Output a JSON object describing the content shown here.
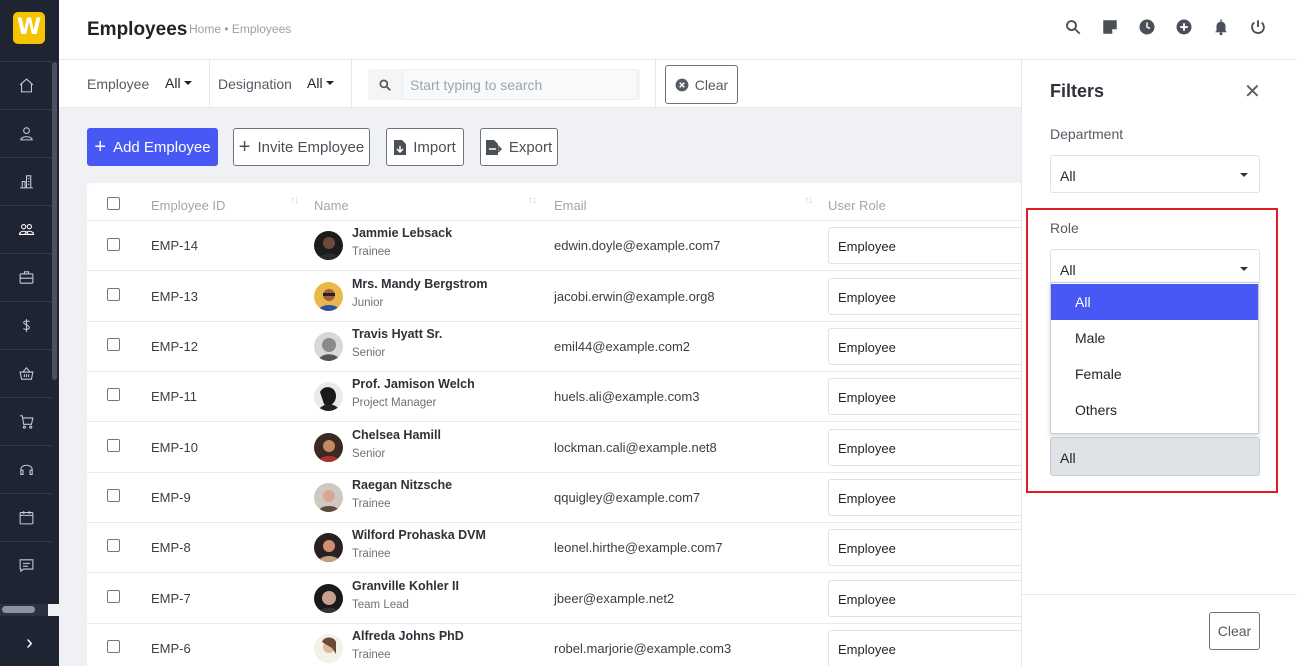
{
  "app": {
    "logo_letter": "W",
    "brand_color": "#f5c400"
  },
  "header": {
    "title": "Employees",
    "breadcrumb": "Home • Employees",
    "icons": [
      "search-icon",
      "sticky-note-icon",
      "clock-icon",
      "plus-circle-icon",
      "bell-icon",
      "power-icon"
    ]
  },
  "sidebar": {
    "items": [
      "home-icon",
      "user-icon",
      "building-icon",
      "users-icon",
      "briefcase-icon",
      "dollar-icon",
      "basket-icon",
      "cart-icon",
      "headset-icon",
      "calendar-icon",
      "message-icon"
    ],
    "expand_glyph": "›"
  },
  "filterbar": {
    "employee_label": "Employee",
    "employee_value": "All",
    "designation_label": "Designation",
    "designation_value": "All",
    "search_placeholder": "Start typing to search",
    "clear_label": "Clear"
  },
  "actions": {
    "add_label": "Add Employee",
    "invite_label": "Invite Employee",
    "import_label": "Import",
    "export_label": "Export",
    "accent_color": "#4758f5"
  },
  "table": {
    "columns": [
      "Employee ID",
      "Name",
      "Email",
      "User Role"
    ],
    "rows": [
      {
        "id": "EMP-14",
        "name": "Jammie Lebsack",
        "designation": "Trainee",
        "email": "edwin.doyle@example.com7",
        "role": "Employee"
      },
      {
        "id": "EMP-13",
        "name": "Mrs. Mandy Bergstrom",
        "designation": "Junior",
        "email": "jacobi.erwin@example.org8",
        "role": "Employee"
      },
      {
        "id": "EMP-12",
        "name": "Travis Hyatt Sr.",
        "designation": "Senior",
        "email": "emil44@example.com2",
        "role": "Employee"
      },
      {
        "id": "EMP-11",
        "name": "Prof. Jamison Welch",
        "designation": "Project Manager",
        "email": "huels.ali@example.com3",
        "role": "Employee"
      },
      {
        "id": "EMP-10",
        "name": "Chelsea Hamill",
        "designation": "Senior",
        "email": "lockman.cali@example.net8",
        "role": "Employee"
      },
      {
        "id": "EMP-9",
        "name": "Raegan Nitzsche",
        "designation": "Trainee",
        "email": "qquigley@example.com7",
        "role": "Employee"
      },
      {
        "id": "EMP-8",
        "name": "Wilford Prohaska DVM",
        "designation": "Trainee",
        "email": "leonel.hirthe@example.com7",
        "role": "Employee"
      },
      {
        "id": "EMP-7",
        "name": "Granville Kohler II",
        "designation": "Team Lead",
        "email": "jbeer@example.net2",
        "role": "Employee"
      },
      {
        "id": "EMP-6",
        "name": "Alfreda Johns PhD",
        "designation": "Trainee",
        "email": "robel.marjorie@example.com3",
        "role": "Employee"
      }
    ]
  },
  "filters_panel": {
    "title": "Filters",
    "close_glyph": "✕",
    "department_label": "Department",
    "department_value": "All",
    "role_label": "Role",
    "role_value": "All",
    "role_options": [
      "All",
      "Male",
      "Female",
      "Others"
    ],
    "role_selected": "All",
    "next_select_value": "All",
    "clear_label": "Clear",
    "highlight_color": "#dc1f26"
  }
}
